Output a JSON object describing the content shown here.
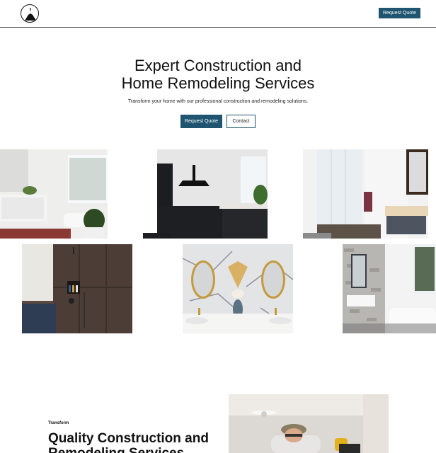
{
  "header": {
    "logo_icon": "mountain-peak-logo-icon",
    "cta_label": "Request Quote"
  },
  "hero": {
    "title_line1": "Expert Construction and",
    "title_line2": "Home Remodeling Services",
    "subtitle": "Transform your home with our professional construction and remodeling solutions.",
    "primary_label": "Request Quote",
    "secondary_label": "Contact"
  },
  "gallery": {
    "images": [
      "white-bathroom-photo",
      "black-kitchen-photo",
      "glass-shower-bathroom-photo",
      "dark-tile-shower-photo",
      "marble-double-vanity-photo",
      "brick-wall-bathroom-photo"
    ]
  },
  "section": {
    "eyebrow": "Transform",
    "title": "Quality Construction and Remodeling Services",
    "image": "worker-installing-ceiling-photo"
  },
  "colors": {
    "accent": "#1f5570",
    "text": "#111111",
    "divider": "#3a3a3a",
    "background": "#ffffff"
  }
}
